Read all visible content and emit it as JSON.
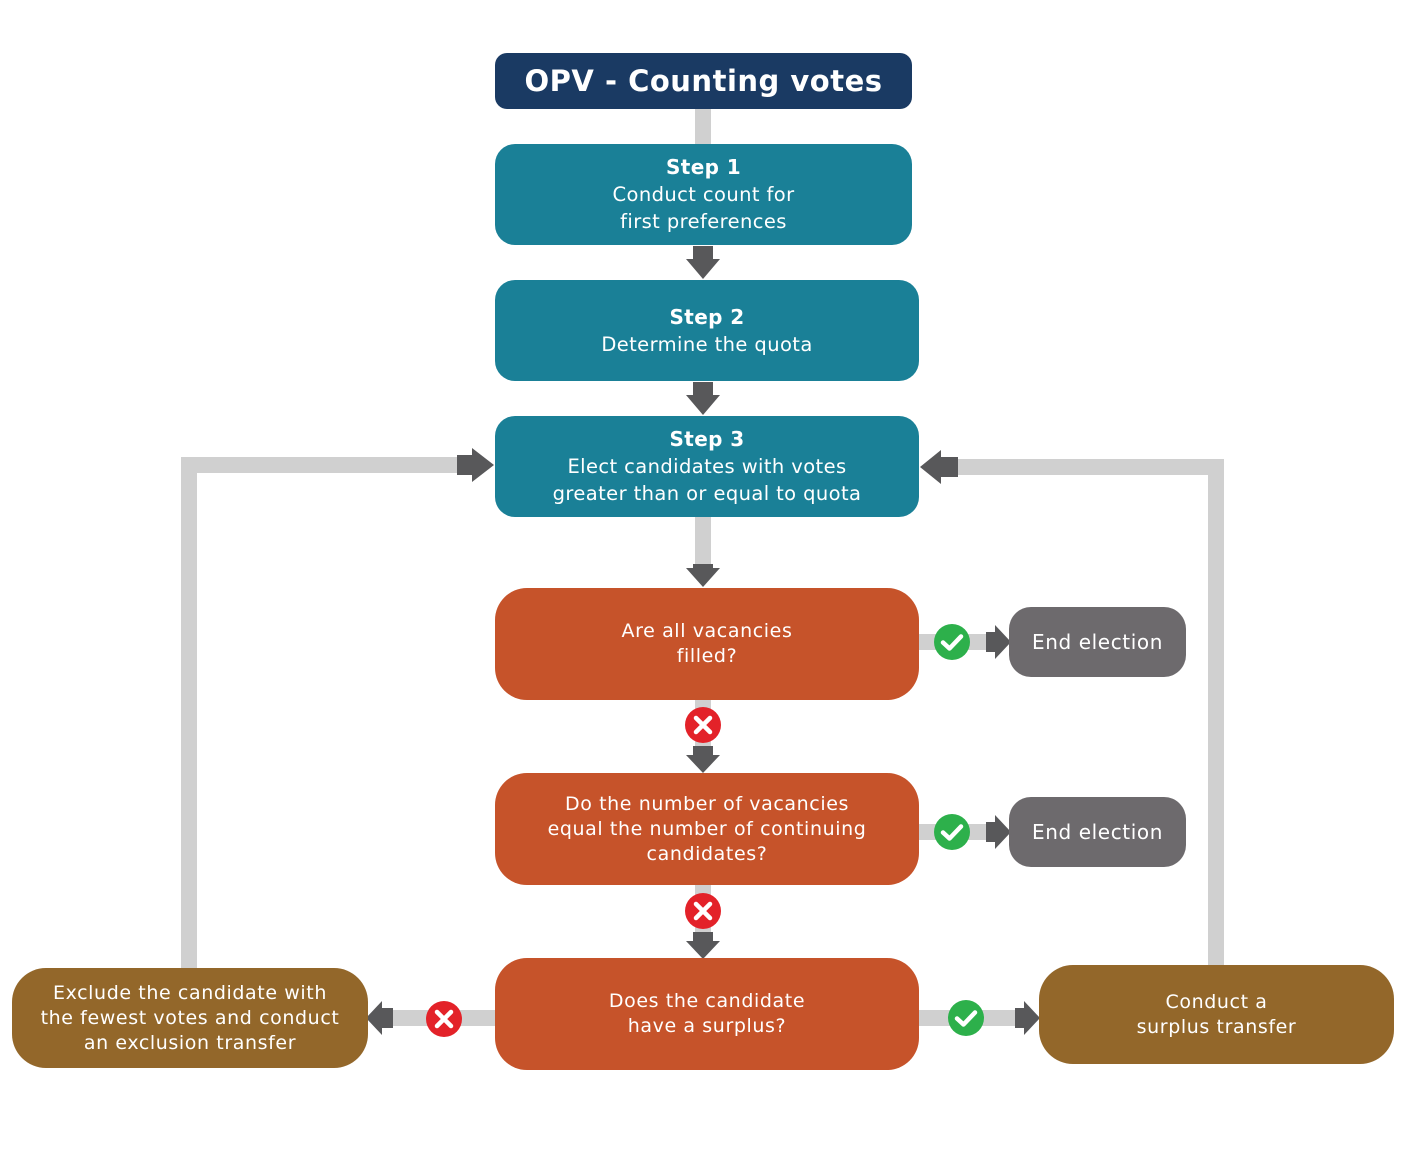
{
  "title": "OPV - Counting votes",
  "steps": [
    {
      "heading": "Step 1",
      "lines": [
        "Conduct count for",
        "first preferences"
      ]
    },
    {
      "heading": "Step 2",
      "lines": [
        "Determine the quota"
      ]
    },
    {
      "heading": "Step 3",
      "lines": [
        "Elect candidates with votes",
        "greater than or equal to quota"
      ]
    }
  ],
  "decisions": [
    {
      "lines": [
        "Are all vacancies",
        "filled?"
      ],
      "yes": "End election",
      "no": "next"
    },
    {
      "lines": [
        "Do the number of vacancies",
        "equal the number of continuing",
        "candidates?"
      ],
      "yes": "End election",
      "no": "next"
    },
    {
      "lines": [
        "Does the candidate",
        "have a surplus?"
      ],
      "yes": "Conduct a surplus transfer",
      "no": "Exclude the candidate"
    }
  ],
  "end_nodes": [
    {
      "label": "End election"
    },
    {
      "label": "End election"
    }
  ],
  "actions": {
    "exclusion": {
      "lines": [
        "Exclude the candidate with",
        "the fewest votes and conduct",
        "an exclusion transfer"
      ]
    },
    "surplus": {
      "lines": [
        "Conduct a",
        "surplus transfer"
      ]
    }
  },
  "icons": {
    "yes": "check-circle-icon",
    "no": "x-circle-icon"
  },
  "colors": {
    "title": "#1a3a63",
    "step": "#1a8097",
    "decision": "#c6532a",
    "end": "#6d6a6d",
    "action": "#93672a",
    "connector": "#d0d0d0",
    "arrow": "#58585a",
    "yes": "#2db04b",
    "no": "#e32229"
  }
}
